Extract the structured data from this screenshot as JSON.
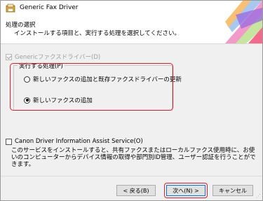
{
  "window": {
    "title": "Generic Fax Driver"
  },
  "header": {
    "title": "処理の選択",
    "subtitle": "インストールする項目と、実行する処理を選択してください。"
  },
  "components": {
    "driver_label": "Genericファクスドライバー(D)",
    "driver_checked": true,
    "driver_enabled": false
  },
  "process_group": {
    "label": "実行する処理(P)",
    "options": [
      {
        "label": "新しいファクスの追加と既存ファクスドライバーの更新",
        "selected": false
      },
      {
        "label": "新しいファクスの追加",
        "selected": true
      }
    ]
  },
  "assist": {
    "label": "Canon Driver Information Assist Service(O)",
    "checked": false,
    "description": "このサービスをインストールすると、共有ファクスまたはローカルファクス使用時に、お使いのコンピューターからデバイス情報の取得や部門別ID管理、ユーザー認証を行うことができます。"
  },
  "footer": {
    "back_label": "< 戻る(B)",
    "next_label": "次へ(N) >",
    "cancel_label": "キャンセル"
  },
  "colors": {
    "highlight": "#e5192a",
    "accent": "#0078d7"
  },
  "icons": {
    "app": "printer-icon",
    "close": "close-icon",
    "decoration": "ribbon-graphic"
  }
}
